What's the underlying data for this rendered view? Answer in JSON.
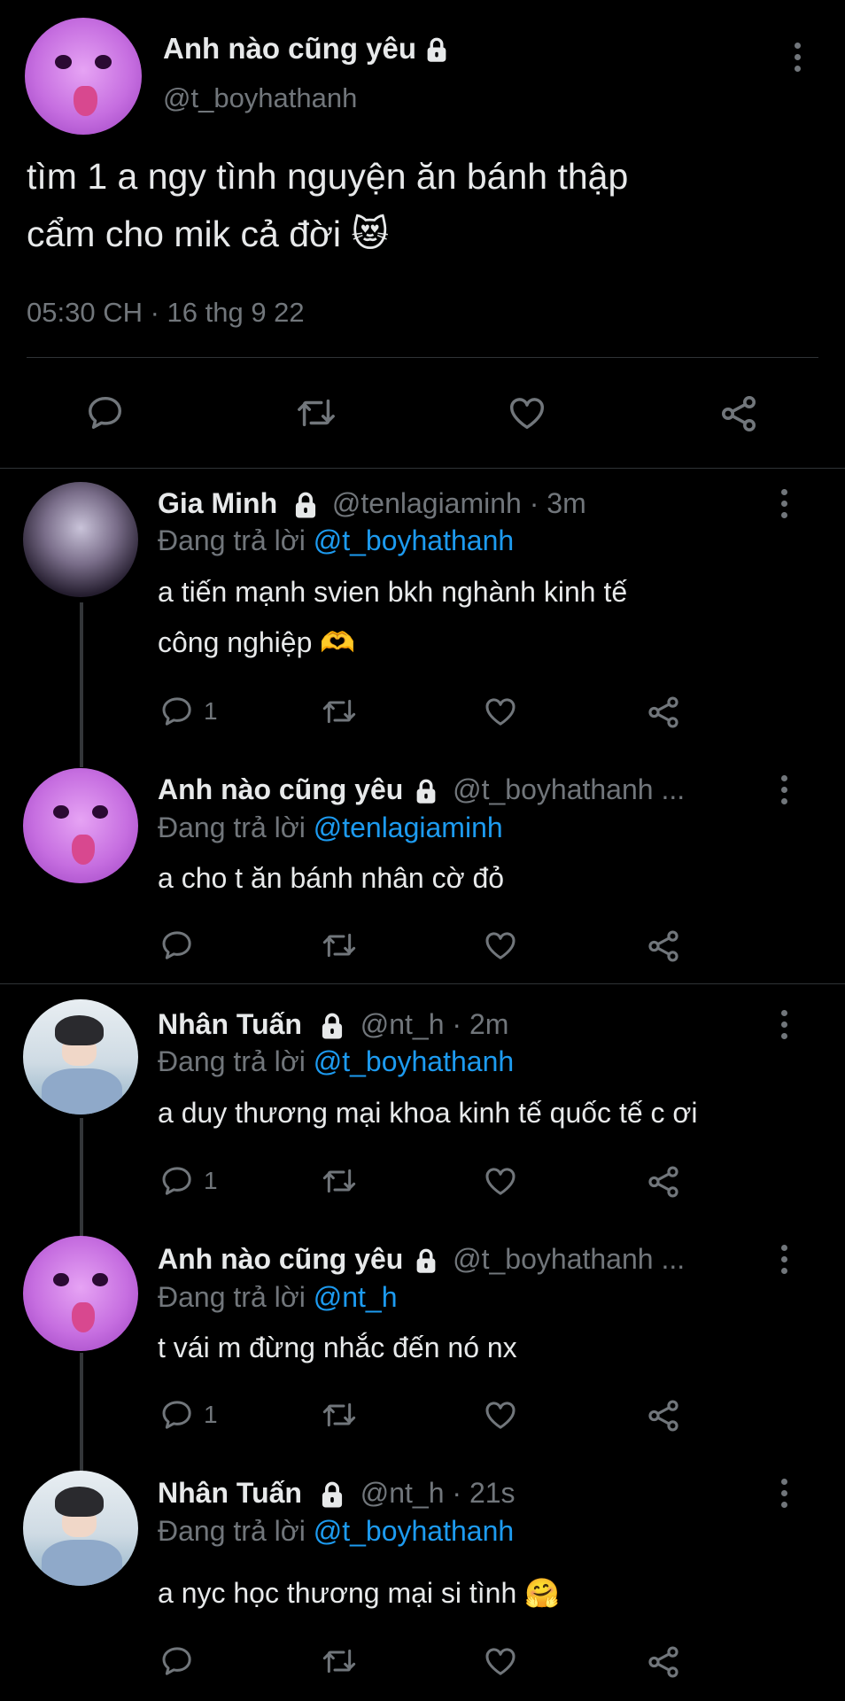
{
  "main_tweet": {
    "display_name": "Anh nào cũng yêu",
    "handle": "@t_boyhathanh",
    "text_line1": "tìm 1 a ngy tình nguyện ăn bánh thập",
    "text_line2": "cẩm cho mik cả đời 😻",
    "timestamp": "05:30 CH · 16 thg 9 22"
  },
  "reply_prefix": "Đang trả lời",
  "replies": [
    {
      "display_name": "Gia Minh",
      "handle": "@tenlagiaminh",
      "meta": "· 3m",
      "replying_to": "@t_boyhathanh",
      "text_line1": "a tiến mạnh svien bkh nghành kinh tế",
      "text_line2": "công nghiệp 🫶",
      "reply_count": "1"
    },
    {
      "display_name": "Anh nào cũng yêu",
      "handle": "@t_boyhathanh ...",
      "meta": "",
      "replying_to": "@tenlagiaminh",
      "text_line1": "a cho t ăn bánh nhân cờ đỏ",
      "text_line2": "",
      "reply_count": ""
    },
    {
      "display_name": "Nhân Tuấn",
      "handle": "@nt_h",
      "meta": "· 2m",
      "replying_to": "@t_boyhathanh",
      "text_line1": "a duy thương mại khoa kinh tế quốc tế c ơi",
      "text_line2": "",
      "reply_count": "1"
    },
    {
      "display_name": "Anh nào cũng yêu",
      "handle": "@t_boyhathanh ...",
      "meta": "",
      "replying_to": "@nt_h",
      "text_line1": "t vái m đừng nhắc đến nó nx",
      "text_line2": "",
      "reply_count": "1"
    },
    {
      "display_name": "Nhân Tuấn",
      "handle": "@nt_h",
      "meta": "· 21s",
      "replying_to": "@t_boyhathanh",
      "text_line1": "a nyc học thương mại si tình 🤗",
      "text_line2": "",
      "reply_count": ""
    }
  ],
  "icons": [
    "reply-icon",
    "retweet-icon",
    "like-icon",
    "share-icon",
    "more-icon",
    "lock-icon"
  ],
  "colors": {
    "background": "#000000",
    "text": "#e7e9ea",
    "muted": "#71767b",
    "link": "#1d9bf0",
    "divider": "#2f3336"
  }
}
